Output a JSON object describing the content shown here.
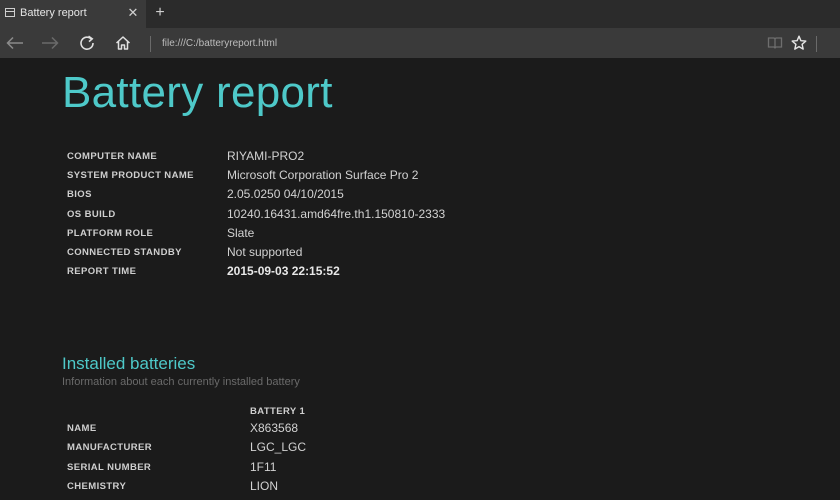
{
  "tab": {
    "title": "Battery report",
    "close_glyph": "✕",
    "new_tab_glyph": "+"
  },
  "navbar": {
    "address": "file:///C:/batteryreport.html"
  },
  "icons": {
    "tab_page": "page-icon",
    "back": "back-arrow-icon",
    "forward": "forward-arrow-icon",
    "refresh": "refresh-icon",
    "home": "home-icon",
    "reading_view": "reading-view-icon",
    "favorite": "star-icon"
  },
  "colors": {
    "accent": "#4ec9c9",
    "background": "#1b1b1b",
    "chrome": "#3a3a3a"
  },
  "report": {
    "title": "Battery report",
    "system_info": [
      {
        "label": "COMPUTER NAME",
        "value": "RIYAMI-PRO2"
      },
      {
        "label": "SYSTEM PRODUCT NAME",
        "value": "Microsoft Corporation Surface Pro 2"
      },
      {
        "label": "BIOS",
        "value": "2.05.0250 04/10/2015"
      },
      {
        "label": "OS BUILD",
        "value": "10240.16431.amd64fre.th1.150810-2333"
      },
      {
        "label": "PLATFORM ROLE",
        "value": "Slate"
      },
      {
        "label": "CONNECTED STANDBY",
        "value": "Not supported"
      },
      {
        "label": "REPORT TIME",
        "value": "2015-09-03  22:15:52"
      }
    ],
    "installed_batteries": {
      "title": "Installed batteries",
      "subtitle": "Information about each currently installed battery",
      "column_header": "BATTERY 1",
      "rows": [
        {
          "label": "NAME",
          "value": "X863568"
        },
        {
          "label": "MANUFACTURER",
          "value": "LGC_LGC"
        },
        {
          "label": "SERIAL NUMBER",
          "value": "1F11"
        },
        {
          "label": "CHEMISTRY",
          "value": "LION"
        }
      ]
    }
  }
}
